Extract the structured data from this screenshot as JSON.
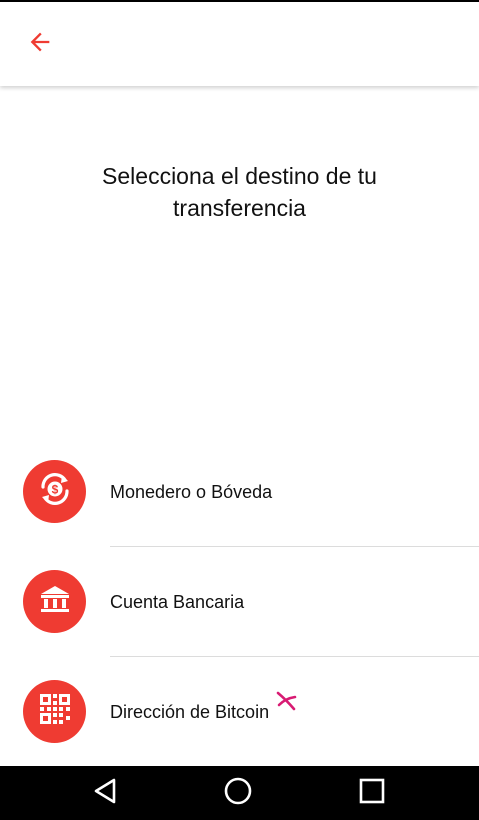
{
  "header": {
    "back_icon": "arrow-left-icon",
    "accent_color": "#ef3b32"
  },
  "main": {
    "title": "Selecciona el destino de tu transferencia"
  },
  "options": [
    {
      "label": "Monedero o Bóveda",
      "icon": "dollar-exchange-icon"
    },
    {
      "label": "Cuenta Bancaria",
      "icon": "bank-icon"
    },
    {
      "label": "Dirección de Bitcoin",
      "icon": "qr-code-icon",
      "badge_icon": "sparkle-icon",
      "badge_color": "#d81b73"
    }
  ],
  "system_nav": {
    "back_icon": "triangle-back-icon",
    "home_icon": "circle-home-icon",
    "recents_icon": "square-recents-icon"
  }
}
